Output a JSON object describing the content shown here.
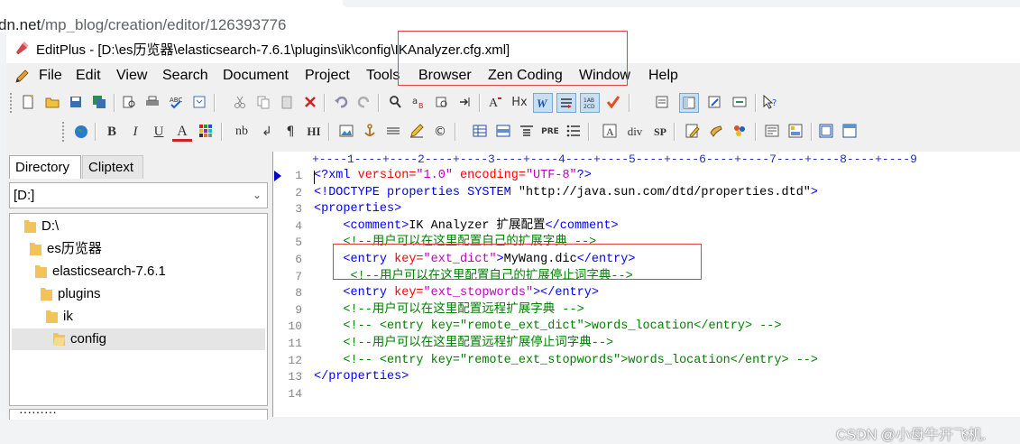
{
  "browser": {
    "url_host": "dn.net",
    "url_path": "/mp_blog/creation/editor/126393776"
  },
  "window": {
    "title": "EditPlus - [D:\\es历览器\\elasticsearch-7.6.1\\plugins\\ik\\config\\IKAnalyzer.cfg.xml]"
  },
  "menu": [
    "File",
    "Edit",
    "View",
    "Search",
    "Document",
    "Project",
    "Tools",
    "Browser",
    "Zen Coding",
    "Window",
    "Help"
  ],
  "toolbar_text": {
    "hx": "Hx",
    "nb": "nb",
    "pilcrow": "¶",
    "hi": "HI",
    "pre": "PRE",
    "div": "div",
    "sp": "SP",
    "bold": "B",
    "italic": "I",
    "underline": "U",
    "fontcolor": "A",
    "newline": "↲",
    "copyright": "©"
  },
  "left_panel": {
    "tabs": [
      "Directory",
      "Cliptext"
    ],
    "drive": "[D:]",
    "tree": [
      "D:\\",
      "es历览器",
      "elasticsearch-7.6.1",
      "plugins",
      "ik",
      "config"
    ],
    "bottom_label": "·········"
  },
  "ruler_text": "+----1----+----2----+----3----+----4----+----5----+----6----+----7----+----8----+----9",
  "editor": {
    "line_numbers": [
      "1",
      "2",
      "3",
      "4",
      "5",
      "6",
      "7",
      "8",
      "9",
      "10",
      "11",
      "12",
      "13",
      "14"
    ],
    "lines": [
      [
        [
          "c-pi",
          "<?xml "
        ],
        [
          "c-attr",
          "version="
        ],
        [
          "c-val",
          "\"1.0\""
        ],
        [
          "c-attr",
          " encoding="
        ],
        [
          "c-val",
          "\"UTF-8\""
        ],
        [
          "c-pi",
          "?>"
        ]
      ],
      [
        [
          "c-tag",
          "<!DOCTYPE properties SYSTEM "
        ],
        [
          "c-txt",
          "\"http://java.sun.com/dtd/properties.dtd\""
        ],
        [
          "c-tag",
          ">"
        ]
      ],
      [
        [
          "c-tag",
          "<properties>"
        ]
      ],
      [
        [
          "c-txt",
          "    "
        ],
        [
          "c-tag",
          "<comment>"
        ],
        [
          "c-txt",
          "IK Analyzer 扩展配置"
        ],
        [
          "c-tag",
          "</comment>"
        ]
      ],
      [
        [
          "c-txt",
          "    "
        ],
        [
          "c-cmt",
          "<!--用户可以在这里配置自己的扩展字典 -->"
        ]
      ],
      [
        [
          "c-txt",
          "    "
        ],
        [
          "c-tag",
          "<entry "
        ],
        [
          "c-attr",
          "key="
        ],
        [
          "c-val",
          "\"ext_dict\""
        ],
        [
          "c-tag",
          ">"
        ],
        [
          "c-txt",
          "MyWang.dic"
        ],
        [
          "c-tag",
          "</entry>"
        ]
      ],
      [
        [
          "c-txt",
          "     "
        ],
        [
          "c-cmt",
          "<!--用户可以在这里配置自己的扩展停止词字典-->"
        ]
      ],
      [
        [
          "c-txt",
          "    "
        ],
        [
          "c-tag",
          "<entry "
        ],
        [
          "c-attr",
          "key="
        ],
        [
          "c-val",
          "\"ext_stopwords\""
        ],
        [
          "c-tag",
          "></entry>"
        ]
      ],
      [
        [
          "c-txt",
          "    "
        ],
        [
          "c-cmt",
          "<!--用户可以在这里配置远程扩展字典 -->"
        ]
      ],
      [
        [
          "c-txt",
          "    "
        ],
        [
          "c-cmt",
          "<!-- <entry key=\"remote_ext_dict\">words_location</entry> -->"
        ]
      ],
      [
        [
          "c-txt",
          "    "
        ],
        [
          "c-cmt",
          "<!--用户可以在这里配置远程扩展停止词字典-->"
        ]
      ],
      [
        [
          "c-txt",
          "    "
        ],
        [
          "c-cmt",
          "<!-- <entry key=\"remote_ext_stopwords\">words_location</entry> -->"
        ]
      ],
      [
        [
          "c-tag",
          "</properties>"
        ]
      ],
      [
        [
          "c-txt",
          ""
        ]
      ]
    ]
  },
  "watermark": "CSDN @小母牛开飞机.",
  "colors": {
    "tag": "#0000ff",
    "attribute": "#ff0000",
    "value": "#c000c0",
    "comment": "#008000",
    "highlight_box": "#e04040",
    "selected_button": "#c7dff3"
  }
}
